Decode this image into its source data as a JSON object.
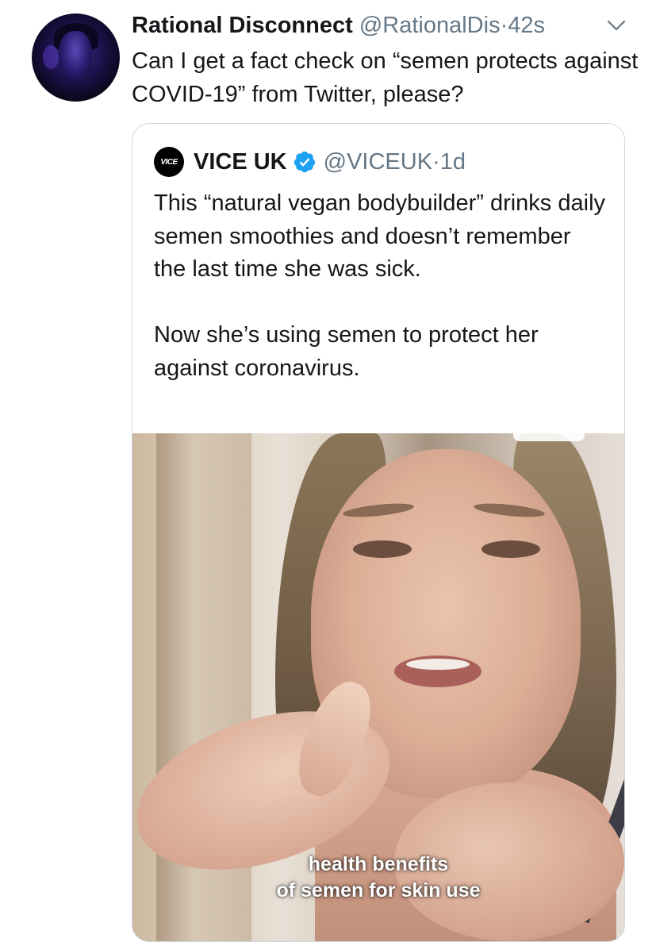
{
  "tweet": {
    "display_name": "Rational Disconnect",
    "handle": "@RationalDis",
    "separator": "·",
    "time": "42s",
    "text": "Can I get a fact check on “semen protects against COVID-19” from Twitter, please?"
  },
  "quoted_tweet": {
    "avatar_text": "VICE",
    "display_name": "VICE UK",
    "handle": "@VICEUK",
    "separator": "·",
    "time": "1d",
    "paragraph_1": "This “natural vegan bodybuilder” drinks daily semen smoothies and doesn’t remember the last time she was sick.",
    "paragraph_2": "Now she’s using semen to protect her against coronavirus.",
    "media": {
      "caption_line_1": "health benefits",
      "caption_line_2": "of semen for skin use"
    }
  },
  "icons": {
    "verified": "verified-badge-icon",
    "caret": "chevron-down-icon"
  },
  "colors": {
    "text_primary": "#14171a",
    "text_secondary": "#657786",
    "verified_blue": "#1da1f2",
    "border": "#ccd6dd"
  }
}
